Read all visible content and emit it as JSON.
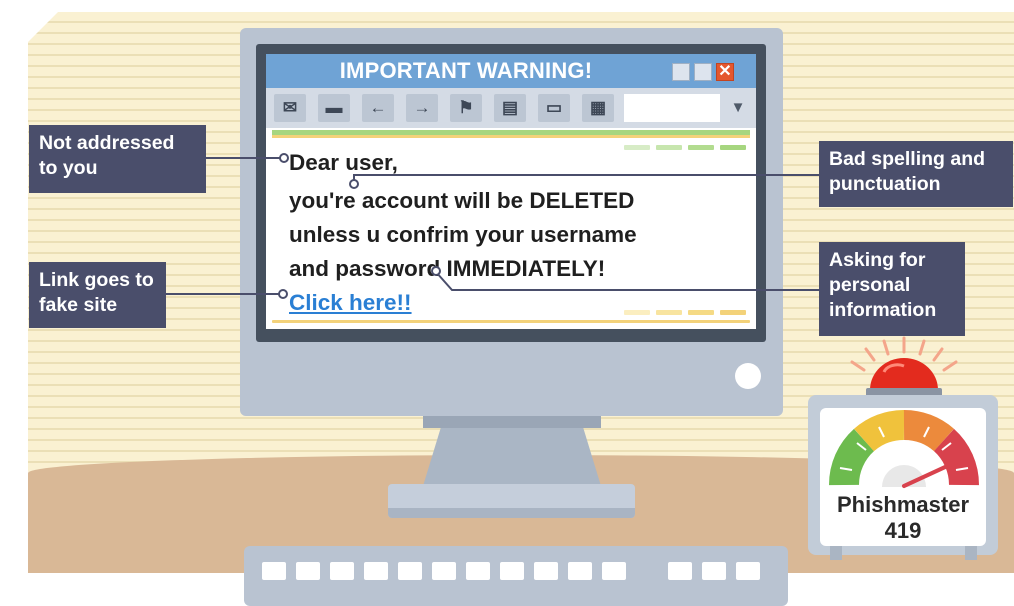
{
  "window": {
    "title": "IMPORTANT WARNING!",
    "close_glyph": "✕",
    "toolbar_icons": [
      "envelope-icon",
      "folder-icon",
      "arrow-left-icon",
      "arrow-right-icon",
      "flag-icon",
      "book-icon",
      "printer-icon",
      "grid-icon"
    ],
    "toolbar_glyphs": [
      "✉",
      "▬",
      "←",
      "→",
      "⚑",
      "▤",
      "▭",
      "▦"
    ],
    "dropdown_glyph": "▼"
  },
  "email": {
    "greeting": "Dear user,",
    "line1": "you're account will be DELETED",
    "line2": "unless u confrim your username",
    "line3": "and password IMMEDIATELY!",
    "link": "Click here!!"
  },
  "callouts": {
    "not_addressed": "Not addressed to you",
    "fake_link": "Link goes to fake site",
    "bad_spelling": "Bad spelling and punctuation",
    "personal_info": "Asking for personal information"
  },
  "meter": {
    "label_line1": "Phishmaster",
    "label_line2": "419"
  },
  "colors": {
    "callout_bg": "#4a4e6b",
    "titlebar": "#6fa3d5",
    "link": "#2a7fd4",
    "gauge_green": "#6dbb4e",
    "gauge_yellow": "#f0c23c",
    "gauge_orange": "#ec8a3c",
    "gauge_red": "#d8424d",
    "siren_red": "#e32b1e"
  }
}
